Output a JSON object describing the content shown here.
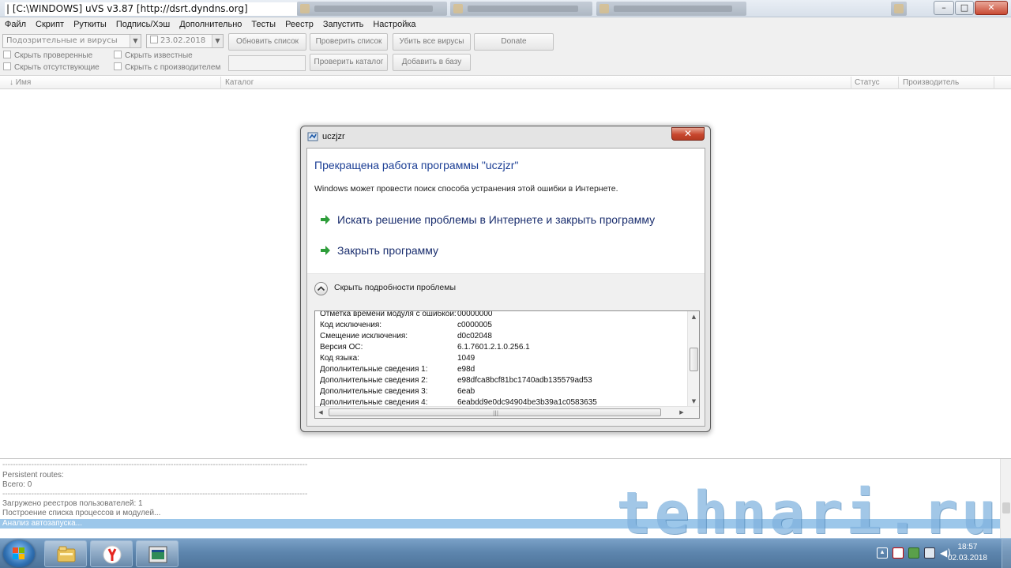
{
  "window": {
    "title": "| [C:\\WINDOWS] uVS v3.87 [http://dsrt.dyndns.org]",
    "controls": {
      "minimize": "–",
      "maximize": "□",
      "close": "✕"
    }
  },
  "menu": [
    "Файл",
    "Скрипт",
    "Руткиты",
    "Подпись/Хэш",
    "Дополнительно",
    "Тесты",
    "Реестр",
    "Запустить",
    "Настройка"
  ],
  "toolbar": {
    "filter_select": "Подозрительные и вирусы",
    "date_select": "23.02.2018",
    "buttons": {
      "refresh_list": "Обновить список",
      "check_list": "Проверить список",
      "kill_viruses": "Убить все вирусы",
      "donate": "Donate",
      "check_folder": "Проверить каталог",
      "add_to_base": "Добавить в базу"
    },
    "checkboxes": {
      "hide_checked": "Скрыть проверенные",
      "hide_known": "Скрыть известные",
      "hide_missing": "Скрыть отсутствующие",
      "hide_with_vendor": "Скрыть с производителем"
    }
  },
  "list": {
    "columns": {
      "name": "↓ Имя",
      "folder": "Каталог",
      "status": "Статус",
      "vendor": "Производитель"
    }
  },
  "log": {
    "lines": [
      "--------------------------------------------------------------------------------------------------------------------",
      "Persistent routes:",
      "Всего: 0",
      "--------------------------------------------------------------------------------------------------------------------",
      "Загружено реестров пользователей: 1",
      "Построение списка процессов и модулей...",
      "Анализ автозапуска..."
    ]
  },
  "watermark": "tehnari.ru",
  "dialog": {
    "title": "uczjzr",
    "close": "✕",
    "heading": "Прекращена работа программы \"uczjzr\"",
    "subtext": "Windows может провести поиск способа устранения этой ошибки в Интернете.",
    "option_search": "Искать решение проблемы в Интернете и закрыть программу",
    "option_close": "Закрыть программу",
    "details_toggle": "Скрыть подробности проблемы",
    "details": [
      {
        "key": "Отметка времени модуля с ошибкой:",
        "value": "00000000"
      },
      {
        "key": "Код исключения:",
        "value": "c0000005"
      },
      {
        "key": "Смещение исключения:",
        "value": "d0c02048"
      },
      {
        "key": "Версия ОС:",
        "value": "6.1.7601.2.1.0.256.1"
      },
      {
        "key": "Код языка:",
        "value": "1049"
      },
      {
        "key": "Дополнительные сведения 1:",
        "value": "e98d"
      },
      {
        "key": "Дополнительные сведения 2:",
        "value": "e98dfca8bcf81bc1740adb135579ad53"
      },
      {
        "key": "Дополнительные сведения 3:",
        "value": "6eab"
      },
      {
        "key": "Дополнительные сведения 4:",
        "value": "6eabdd9e0dc94904be3b39a1c0583635"
      }
    ]
  },
  "taskbar": {
    "apps": [
      "explorer-icon",
      "yandex-browser-icon",
      "uvs-icon"
    ],
    "clock_time": "18:57",
    "clock_date": "02.03.2018"
  },
  "colors": {
    "dialog_heading": "#1c3f95",
    "log_highlight": "#9cc7ea",
    "close_red": "#c8472e",
    "arrow_green": "#2e9d3a"
  }
}
